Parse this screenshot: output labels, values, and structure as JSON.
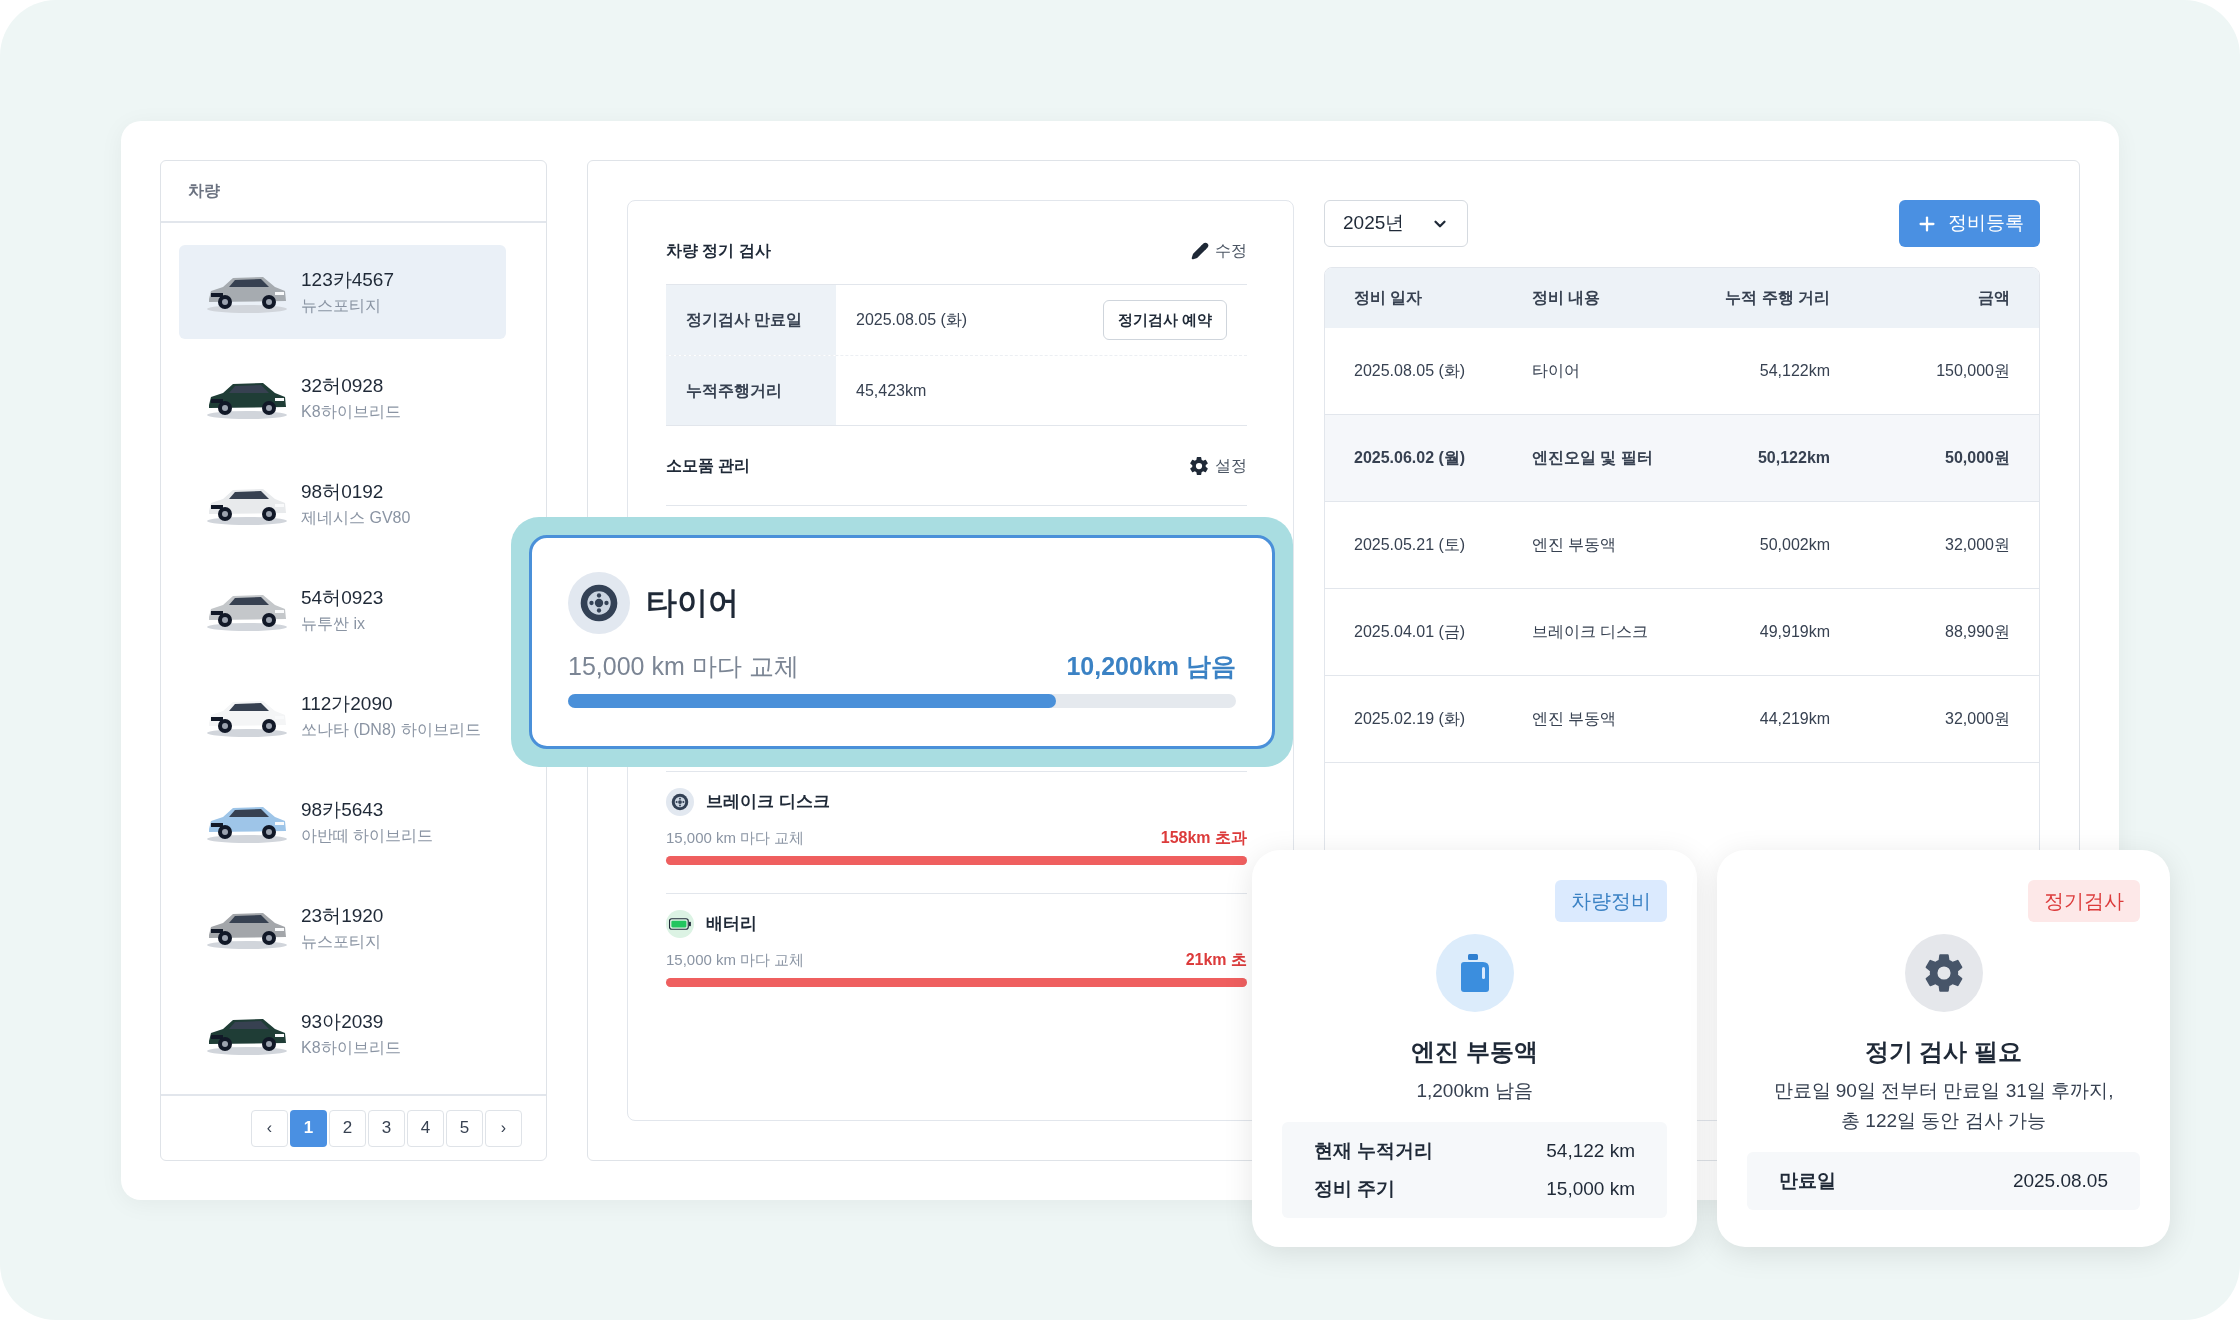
{
  "sidebar": {
    "title": "차량",
    "vehicles": [
      {
        "plate": "123카4567",
        "model": "뉴스포티지",
        "selected": true
      },
      {
        "plate": "32허0928",
        "model": "K8하이브리드",
        "selected": false
      },
      {
        "plate": "98허0192",
        "model": "제네시스 GV80",
        "selected": false
      },
      {
        "plate": "54허0923",
        "model": "뉴투싼 ix",
        "selected": false
      },
      {
        "plate": "112가2090",
        "model": "쏘나타 (DN8) 하이브리드",
        "selected": false
      },
      {
        "plate": "98카5643",
        "model": "아반떼 하이브리드",
        "selected": false
      },
      {
        "plate": "23허1920",
        "model": "뉴스포티지",
        "selected": false
      },
      {
        "plate": "93아2039",
        "model": "K8하이브리드",
        "selected": false
      }
    ],
    "pagination": {
      "prev": "‹",
      "next": "›",
      "pages": [
        {
          "label": "1",
          "selected": true
        },
        {
          "label": "2",
          "selected": false
        },
        {
          "label": "3",
          "selected": false
        },
        {
          "label": "4",
          "selected": false
        },
        {
          "label": "5",
          "selected": false
        }
      ]
    }
  },
  "inspection": {
    "title": "차량 정기 검사",
    "edit": "수정",
    "fields": [
      {
        "label": "정기검사 만료일",
        "value": "2025.08.05 (화)",
        "button": "정기검사 예약"
      },
      {
        "label": "누적주행거리",
        "value": "45,423km"
      }
    ]
  },
  "consumables": {
    "title": "소모품 관리",
    "settings": "설정",
    "items": [
      {
        "kind": "disc",
        "name": "브레이크 디스크",
        "interval": "15,000 km 마다 교체",
        "reading": "158km 초과",
        "overdue": true,
        "level": 1
      },
      {
        "kind": "battery",
        "name": "배터리",
        "interval": "15,000 km 마다 교체",
        "reading": "21km 초",
        "overdue": true,
        "level": 1
      }
    ]
  },
  "highlight": {
    "kind": "tire",
    "name": "타이어",
    "interval": "15,000 km 마다 교체",
    "reading": "10,200km 남음",
    "overdue": false,
    "level": 0.73
  },
  "maintenance": {
    "year": "2025년",
    "add_button": "정비등록",
    "columns": [
      "정비 일자",
      "정비 내용",
      "누적 주행 거리",
      "금액"
    ],
    "rows": [
      {
        "date": "2025.08.05 (화)",
        "item": "타이어",
        "mileage": "54,122km",
        "amount": "150,000원",
        "selected": false
      },
      {
        "date": "2025.06.02 (월)",
        "item": "엔진오일 및 필터",
        "mileage": "50,122km",
        "amount": "50,000원",
        "selected": true
      },
      {
        "date": "2025.05.21 (토)",
        "item": "엔진 부동액",
        "mileage": "50,002km",
        "amount": "32,000원",
        "selected": false
      },
      {
        "date": "2025.04.01 (금)",
        "item": "브레이크 디스크",
        "mileage": "49,919km",
        "amount": "88,990원",
        "selected": false
      },
      {
        "date": "2025.02.19 (화)",
        "item": "엔진 부동액",
        "mileage": "44,219km",
        "amount": "32,000원",
        "selected": false
      }
    ]
  },
  "cards": [
    {
      "kind": "maintenance",
      "tag": "차량정비",
      "title": "엔진 부동액",
      "subtitle": "1,200km 남음",
      "details": [
        {
          "label": "현재 누적거리",
          "value": "54,122 km"
        },
        {
          "label": "정비 주기",
          "value": "15,000 km"
        }
      ]
    },
    {
      "kind": "inspection",
      "tag": "정기검사",
      "title": "정기 검사 필요",
      "subtitle": "만료일 90일 전부터 만료일 31일 후까지,\n총 122일 동안 검사 가능",
      "details": [
        {
          "label": "만료일",
          "value": "2025.08.05"
        }
      ]
    }
  ]
}
